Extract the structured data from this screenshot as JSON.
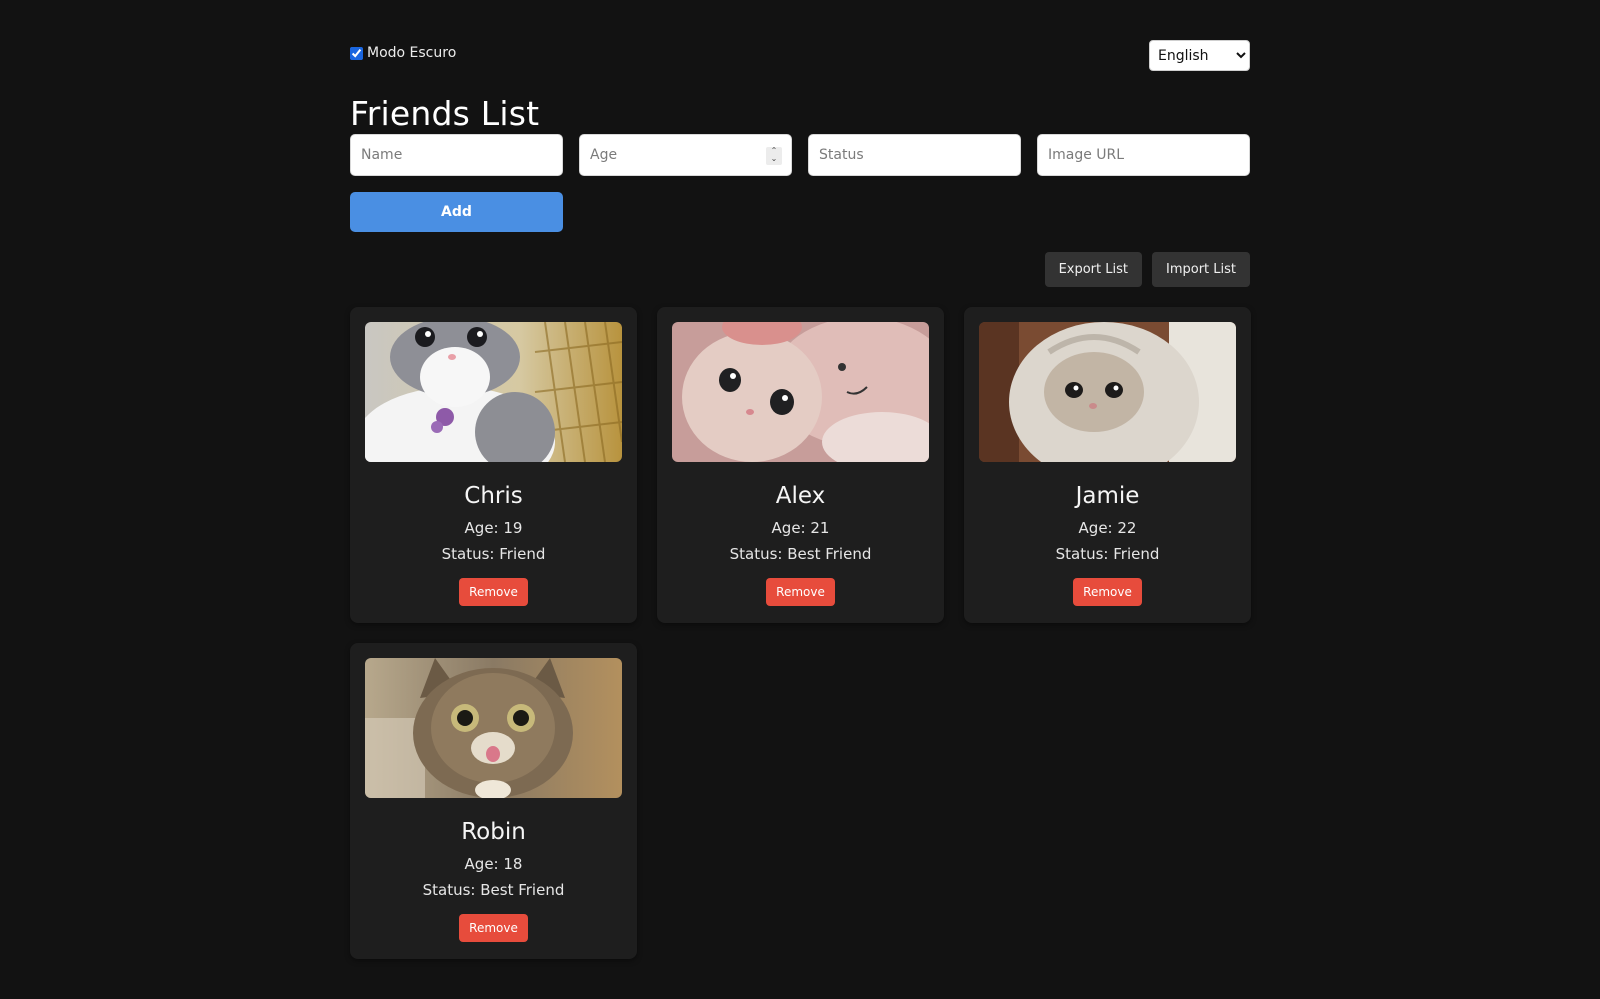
{
  "settings": {
    "dark_mode_label": "Modo Escuro",
    "dark_mode_checked": true,
    "language_selected": "English"
  },
  "page": {
    "title": "Friends List"
  },
  "form": {
    "name_placeholder": "Name",
    "age_placeholder": "Age",
    "status_placeholder": "Status",
    "image_placeholder": "Image URL",
    "add_label": "Add"
  },
  "actions": {
    "export_label": "Export List",
    "import_label": "Import List"
  },
  "friends": [
    {
      "name": "Chris",
      "age_text": "Age: 19",
      "status_text": "Status: Friend",
      "remove_label": "Remove"
    },
    {
      "name": "Alex",
      "age_text": "Age: 21",
      "status_text": "Status: Best Friend",
      "remove_label": "Remove"
    },
    {
      "name": "Jamie",
      "age_text": "Age: 22",
      "status_text": "Status: Friend",
      "remove_label": "Remove"
    },
    {
      "name": "Robin",
      "age_text": "Age: 18",
      "status_text": "Status: Best Friend",
      "remove_label": "Remove"
    }
  ],
  "colors": {
    "background": "#121212",
    "card": "#1e1e1e",
    "accent": "#4a8fe3",
    "danger": "#e74c3c"
  }
}
